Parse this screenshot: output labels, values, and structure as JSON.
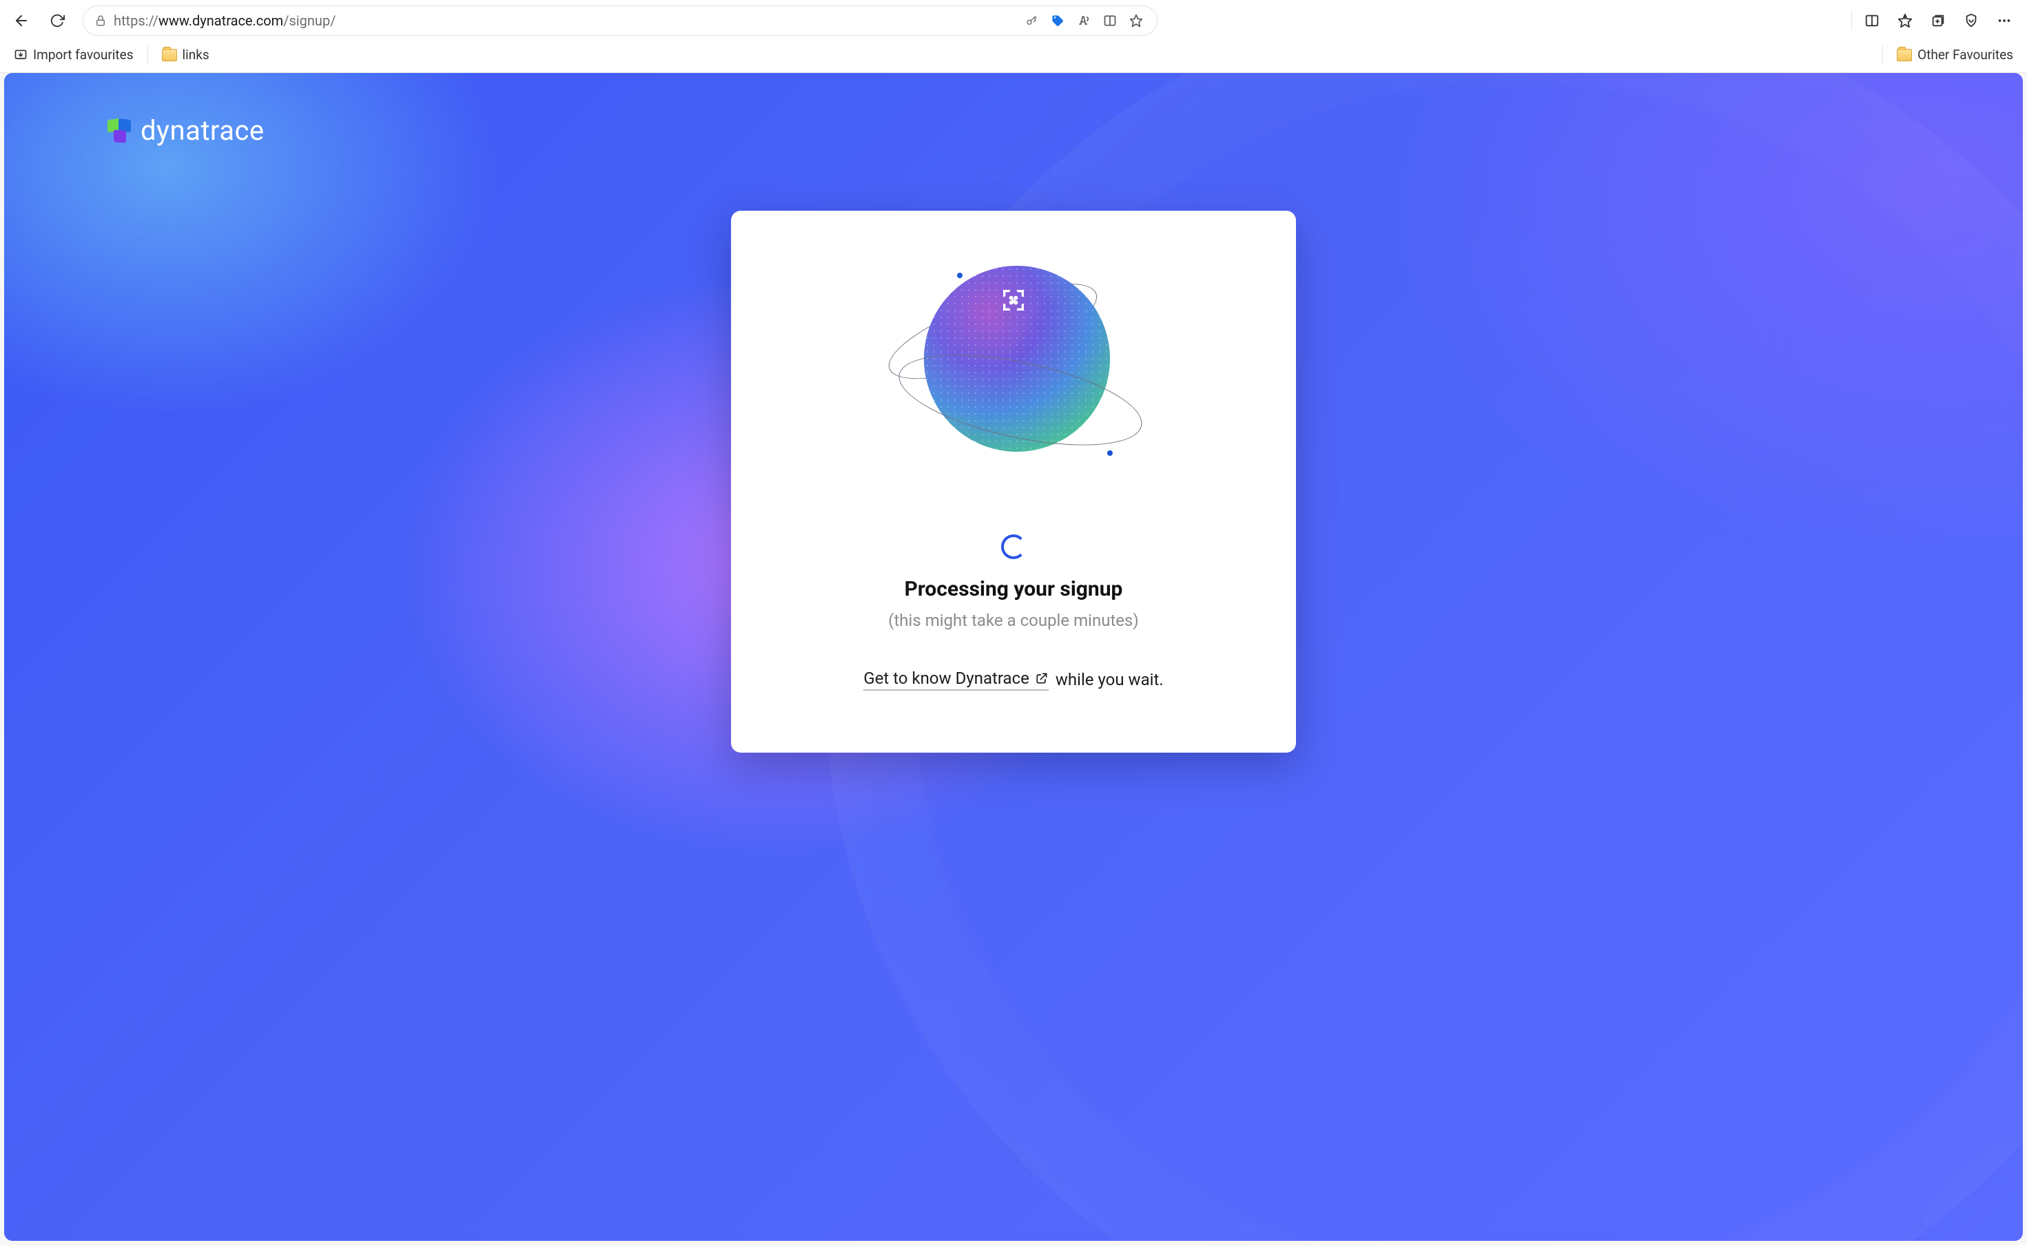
{
  "browser": {
    "url_host": "www.dynatrace.com",
    "url_protocol": "https://",
    "url_path": "/signup/",
    "bookmarks": {
      "import": "Import favourites",
      "links": "links",
      "other": "Other Favourites"
    }
  },
  "brand": {
    "name": "dynatrace"
  },
  "card": {
    "heading": "Processing your signup",
    "subtext": "(this might take a couple minutes)",
    "cta_link": "Get to know Dynatrace",
    "cta_suffix": " while you wait."
  }
}
